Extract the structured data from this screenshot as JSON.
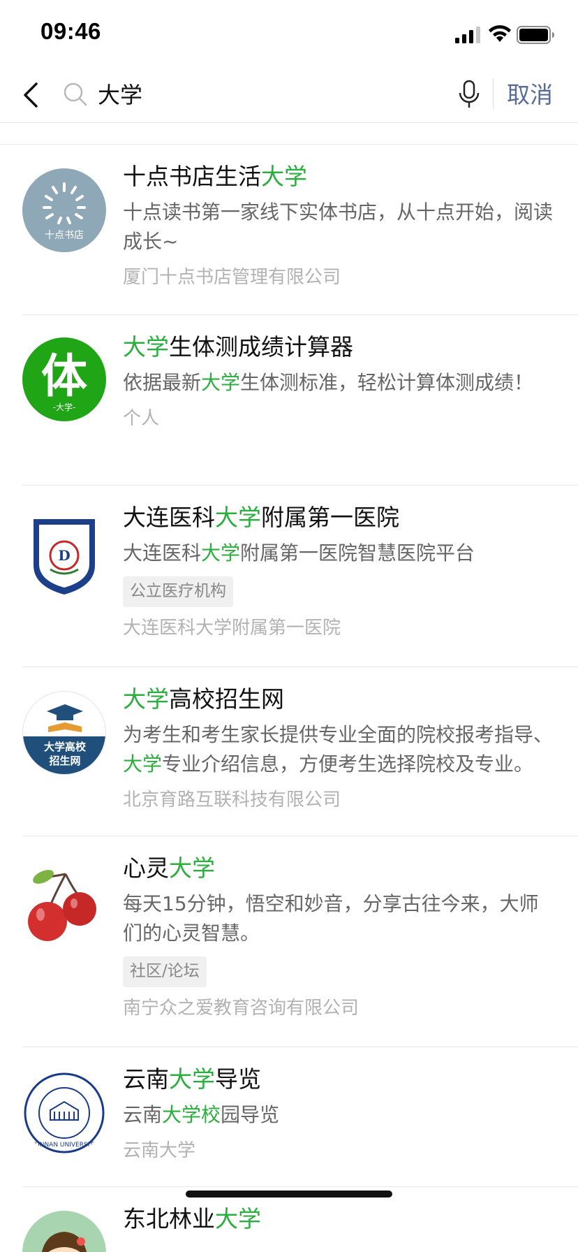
{
  "status": {
    "time": "09:46"
  },
  "search": {
    "query": "大学",
    "cancel_label": "取消"
  },
  "colors": {
    "highlight": "#2aae3e",
    "link": "#576b95",
    "avatar_tizhi": "#1fa516",
    "avatar_shidian": "#8fa8b8",
    "avatar_gaoxiao": "#1f4f7a"
  },
  "results": [
    {
      "title_parts": [
        "十点书店生活",
        "大学",
        ""
      ],
      "desc": "十点读书第一家线下实体书店，从十点开始，阅读成长~",
      "owner": "厦门十点书店管理有限公司",
      "avatar_icon": "shidian-logo-icon",
      "avatar_text": "十点书店"
    },
    {
      "title_parts": [
        "",
        "大学",
        "生体测成绩计算器"
      ],
      "desc_parts": [
        "依据最新",
        "大学",
        "生体测标准，轻松计算体测成绩！"
      ],
      "owner": "个人",
      "avatar_icon": "ti-character-icon",
      "avatar_text": "体",
      "avatar_sub": "-大学-"
    },
    {
      "title_parts": [
        "大连医科",
        "大学",
        "附属第一医院"
      ],
      "desc_parts": [
        "大连医科",
        "大学",
        "附属第一医院智慧医院平台"
      ],
      "tag": "公立医疗机构",
      "owner": "大连医科大学附属第一医院",
      "avatar_icon": "hospital-shield-icon"
    },
    {
      "title_parts": [
        "",
        "大学",
        "高校招生网"
      ],
      "desc_parts": [
        "为考生和考生家长提供专业全面的院校报考指导、",
        "大学",
        "专业介绍信息，方便考生选择院校及专业。"
      ],
      "owner": "北京育路互联科技有限公司",
      "avatar_icon": "graduation-cap-icon",
      "avatar_text_1": "大学高校",
      "avatar_text_2": "招生网"
    },
    {
      "title_parts": [
        "心灵",
        "大学",
        ""
      ],
      "desc": "每天15分钟，悟空和妙音，分享古往今来，大师们的心灵智慧。",
      "tag": "社区/论坛",
      "owner": "南宁众之爱教育咨询有限公司",
      "avatar_icon": "cherry-icon"
    },
    {
      "title_parts": [
        "云南",
        "大学",
        "导览"
      ],
      "desc_parts": [
        "云南",
        "大学校",
        "园导览"
      ],
      "owner": "云南大学",
      "avatar_icon": "yunnan-university-seal-icon",
      "avatar_text": "YUNNAN UNIVERSITY"
    },
    {
      "title_parts": [
        "东北林业",
        "大学",
        ""
      ],
      "avatar_icon": "cartoon-girl-icon"
    }
  ]
}
